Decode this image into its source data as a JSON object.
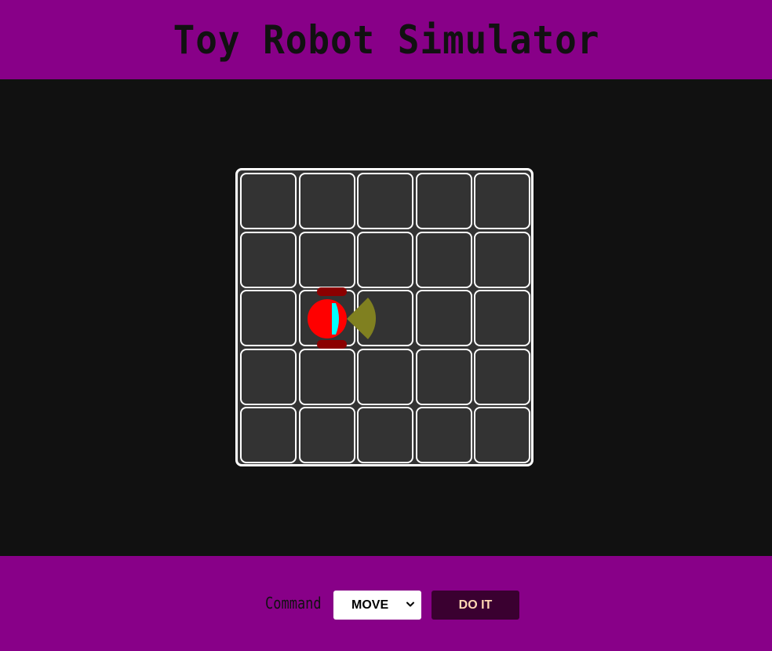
{
  "header": {
    "title": "Toy Robot Simulator"
  },
  "board": {
    "rows": 5,
    "cols": 5,
    "robot": {
      "row": 3,
      "col": 2,
      "facing": "EAST"
    }
  },
  "controls": {
    "command_label": "Command",
    "command_selected": "MOVE",
    "submit_label": "DO IT"
  },
  "colors": {
    "header_bg": "#880088",
    "stage_bg": "#111111",
    "cell_bg": "#333333",
    "robot_body": "#ff0000",
    "robot_wheels": "#8b0000",
    "robot_eye": "#00ffff",
    "sensor_cone": "#808020",
    "button_bg": "#3a0030",
    "button_text": "#ffd9b3"
  }
}
